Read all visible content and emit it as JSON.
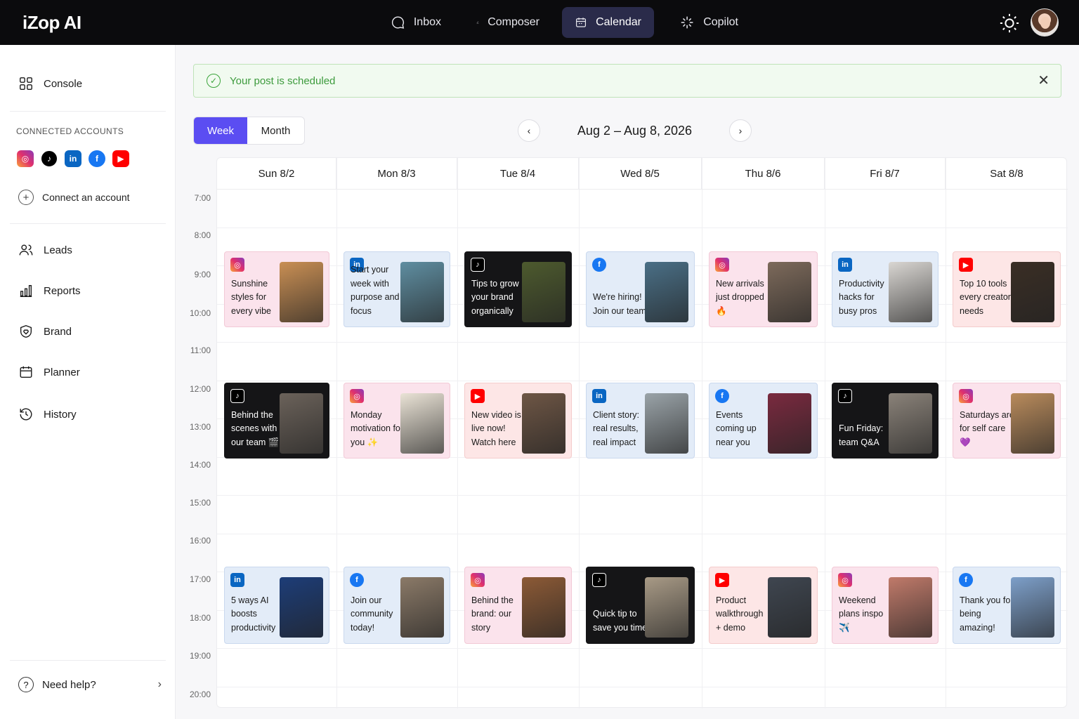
{
  "app": {
    "name": "iZop AI"
  },
  "nav": [
    {
      "label": "Inbox",
      "icon": "chat-bubble-icon",
      "active": false
    },
    {
      "label": "Composer",
      "icon": "pen-icon",
      "active": false
    },
    {
      "label": "Calendar",
      "icon": "calendar-icon",
      "active": true
    },
    {
      "label": "Copilot",
      "icon": "sparkle-icon",
      "active": false
    }
  ],
  "sidebar": {
    "console": "Console",
    "accounts_title": "CONNECTED ACCOUNTS",
    "connect": "Connect an account",
    "items": [
      "Leads",
      "Reports",
      "Brand",
      "Planner",
      "History"
    ],
    "help": "Need help?"
  },
  "banner": {
    "message": "Your post is scheduled"
  },
  "view": {
    "week": "Week",
    "month": "Month",
    "selected": "Week"
  },
  "range_label": "Aug 2 – Aug 8, 2026",
  "days": [
    "Sun 8/2",
    "Mon 8/3",
    "Tue 8/4",
    "Wed 8/5",
    "Thu 8/6",
    "Fri 8/7",
    "Sat 8/8"
  ],
  "times": [
    "7:00",
    "8:00",
    "9:00",
    "10:00",
    "11:00",
    "12:00",
    "13:00",
    "14:00",
    "15:00",
    "16:00",
    "17:00",
    "18:00",
    "19:00",
    "20:00"
  ],
  "posts": [
    {
      "day": 0,
      "slot": "morning",
      "platform": "instagram",
      "text": "Sunshine styles for every vibe",
      "thumb_color": "#c98f54"
    },
    {
      "day": 1,
      "slot": "morning",
      "platform": "linkedin",
      "text": "Start your week with purpose and focus",
      "thumb_color": "#5f8ea1"
    },
    {
      "day": 2,
      "slot": "morning",
      "platform": "tiktok",
      "text": "Tips to grow your brand organically",
      "thumb_color": "#4d5a2e"
    },
    {
      "day": 3,
      "slot": "morning",
      "platform": "facebook",
      "text": "We're hiring! Join our team",
      "thumb_color": "#4a6f86"
    },
    {
      "day": 4,
      "slot": "morning",
      "platform": "instagram",
      "text": "New arrivals just dropped 🔥",
      "thumb_color": "#7d6a5b"
    },
    {
      "day": 5,
      "slot": "morning",
      "platform": "linkedin",
      "text": "Productivity hacks for busy pros",
      "thumb_color": "#d9d6d2"
    },
    {
      "day": 6,
      "slot": "morning",
      "platform": "youtube",
      "text": "Top 10 tools every creator needs",
      "thumb_color": "#3a2e25"
    },
    {
      "day": 0,
      "slot": "noon",
      "platform": "tiktok",
      "text": "Behind the scenes with our team 🎬",
      "thumb_color": "#6b625a"
    },
    {
      "day": 1,
      "slot": "noon",
      "platform": "instagram",
      "text": "Monday motivation for you ✨",
      "thumb_color": "#eae3d6"
    },
    {
      "day": 2,
      "slot": "noon",
      "platform": "youtube",
      "text": "New video is live now! Watch here",
      "thumb_color": "#6e5645"
    },
    {
      "day": 3,
      "slot": "noon",
      "platform": "linkedin",
      "text": "Client story: real results, real impact",
      "thumb_color": "#9aa3a8"
    },
    {
      "day": 4,
      "slot": "noon",
      "platform": "facebook",
      "text": "Events coming up near you",
      "thumb_color": "#7a2a3f"
    },
    {
      "day": 5,
      "slot": "noon",
      "platform": "tiktok",
      "text": "Fun Friday: team Q&A",
      "thumb_color": "#8a8279"
    },
    {
      "day": 6,
      "slot": "noon",
      "platform": "instagram",
      "text": "Saturdays are for self care 💜",
      "thumb_color": "#b98b5c"
    },
    {
      "day": 0,
      "slot": "evening",
      "platform": "linkedin",
      "text": "5 ways AI boosts productivity",
      "thumb_color": "#1d3d78"
    },
    {
      "day": 1,
      "slot": "evening",
      "platform": "facebook",
      "text": "Join our community today!",
      "thumb_color": "#8b7a68"
    },
    {
      "day": 2,
      "slot": "evening",
      "platform": "instagram",
      "text": "Behind the brand: our story",
      "thumb_color": "#8c5a36"
    },
    {
      "day": 3,
      "slot": "evening",
      "platform": "tiktok",
      "text": "Quick tip to save you time",
      "thumb_color": "#a89a86"
    },
    {
      "day": 4,
      "slot": "evening",
      "platform": "youtube",
      "text": "Product walkthrough + demo",
      "thumb_color": "#3f4650"
    },
    {
      "day": 5,
      "slot": "evening",
      "platform": "instagram",
      "text": "Weekend plans inspo ✈️",
      "thumb_color": "#c07a6a"
    },
    {
      "day": 6,
      "slot": "evening",
      "platform": "facebook",
      "text": "Thank you for being amazing!",
      "thumb_color": "#7d9fc9"
    }
  ]
}
